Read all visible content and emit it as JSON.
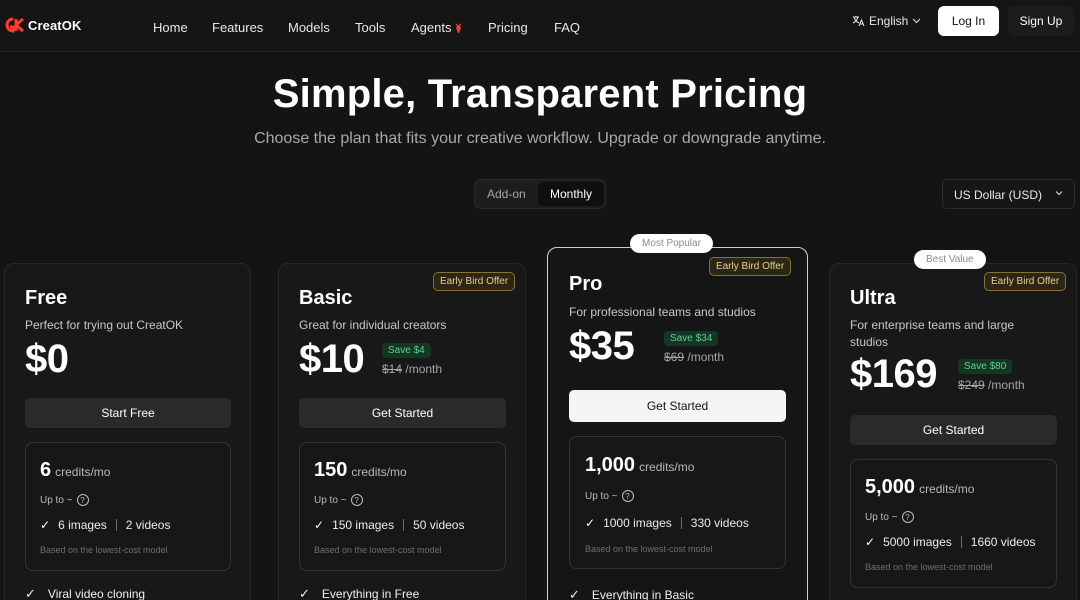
{
  "nav": {
    "logo_text": "CreatOK",
    "links": [
      "Home",
      "Features",
      "Models",
      "Tools",
      "Agents",
      "Pricing",
      "FAQ"
    ],
    "language": "English",
    "login": "Log In",
    "signup": "Sign Up"
  },
  "hero": {
    "title": "Simple, Transparent Pricing",
    "subtitle": "Choose the plan that fits your creative workflow. Upgrade or downgrade anytime."
  },
  "billing_toggle": {
    "addon": "Add-on",
    "monthly": "Monthly",
    "selected": "Monthly"
  },
  "currency": "US Dollar (USD)",
  "colors": {
    "accent_save": "#59d38c",
    "early_bird": "#e9cf86",
    "background": "#141414"
  },
  "plans": [
    {
      "name": "Free",
      "desc": "Perfect for trying out CreatOK",
      "price": "$0",
      "cta": "Start Free",
      "credits": "6",
      "credits_unit": "credits/mo",
      "upto": "Up to ~",
      "images": "6 images",
      "videos": "2 videos",
      "basis": "Based on the lowest-cost model",
      "feature": "Viral video cloning"
    },
    {
      "name": "Basic",
      "badge": "Early Bird Offer",
      "desc": "Great for individual creators",
      "price": "$10",
      "save": "Save $4",
      "old_price": "$14",
      "per": "/month",
      "cta": "Get Started",
      "credits": "150",
      "credits_unit": "credits/mo",
      "upto": "Up to ~",
      "images": "150 images",
      "videos": "50 videos",
      "basis": "Based on the lowest-cost model",
      "feature": "Everything in Free"
    },
    {
      "name": "Pro",
      "tag": "Most Popular",
      "badge": "Early Bird Offer",
      "desc": "For professional teams and studios",
      "price": "$35",
      "save": "Save $34",
      "old_price": "$69",
      "per": "/month",
      "cta": "Get Started",
      "credits": "1,000",
      "credits_unit": "credits/mo",
      "upto": "Up to ~",
      "images": "1000 images",
      "videos": "330 videos",
      "basis": "Based on the lowest-cost model",
      "feature": "Everything in Basic"
    },
    {
      "name": "Ultra",
      "tag": "Best Value",
      "badge": "Early Bird Offer",
      "desc": "For enterprise teams and large studios",
      "price": "$169",
      "save": "Save $80",
      "old_price": "$249",
      "per": "/month",
      "cta": "Get Started",
      "credits": "5,000",
      "credits_unit": "credits/mo",
      "upto": "Up to ~",
      "images": "5000 images",
      "videos": "1660 videos",
      "basis": "Based on the lowest-cost model"
    }
  ]
}
